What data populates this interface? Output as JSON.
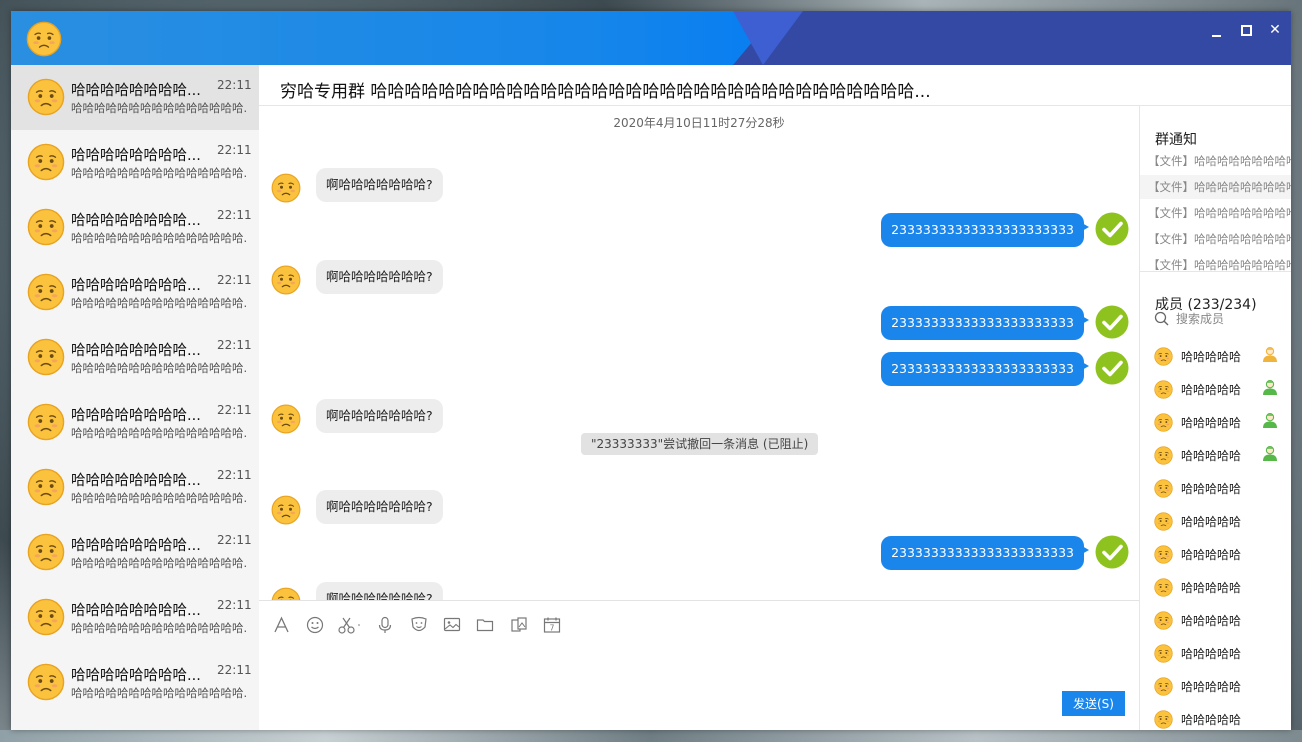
{
  "titlebar": {
    "controls": {
      "minimize_icon": "minimize-icon",
      "maximize_icon": "maximize-icon",
      "close_label": "✕"
    }
  },
  "sidebar": {
    "items": [
      {
        "name": "哈哈哈哈哈哈哈哈...",
        "time": "22:11",
        "preview": "哈哈哈哈哈哈哈哈哈哈哈哈哈哈哈...",
        "active": true
      },
      {
        "name": "哈哈哈哈哈哈哈哈...",
        "time": "22:11",
        "preview": "哈哈哈哈哈哈哈哈哈哈哈哈哈哈哈..."
      },
      {
        "name": "哈哈哈哈哈哈哈哈...",
        "time": "22:11",
        "preview": "哈哈哈哈哈哈哈哈哈哈哈哈哈哈哈..."
      },
      {
        "name": "哈哈哈哈哈哈哈哈...",
        "time": "22:11",
        "preview": "哈哈哈哈哈哈哈哈哈哈哈哈哈哈哈..."
      },
      {
        "name": "哈哈哈哈哈哈哈哈...",
        "time": "22:11",
        "preview": "哈哈哈哈哈哈哈哈哈哈哈哈哈哈哈..."
      },
      {
        "name": "哈哈哈哈哈哈哈哈...",
        "time": "22:11",
        "preview": "哈哈哈哈哈哈哈哈哈哈哈哈哈哈哈..."
      },
      {
        "name": "哈哈哈哈哈哈哈哈...",
        "time": "22:11",
        "preview": "哈哈哈哈哈哈哈哈哈哈哈哈哈哈哈..."
      },
      {
        "name": "哈哈哈哈哈哈哈哈...",
        "time": "22:11",
        "preview": "哈哈哈哈哈哈哈哈哈哈哈哈哈哈哈..."
      },
      {
        "name": "哈哈哈哈哈哈哈哈...",
        "time": "22:11",
        "preview": "哈哈哈哈哈哈哈哈哈哈哈哈哈哈哈..."
      },
      {
        "name": "哈哈哈哈哈哈哈哈...",
        "time": "22:11",
        "preview": "哈哈哈哈哈哈哈哈哈哈哈哈哈哈哈..."
      }
    ]
  },
  "chat": {
    "title": "穷哈专用群 哈哈哈哈哈哈哈哈哈哈哈哈哈哈哈哈哈哈哈哈哈哈哈哈哈哈哈哈哈哈哈哈...",
    "timestamp": "2020年4月10日11时27分28秒",
    "messages": [
      {
        "dir": "in",
        "text": "啊哈哈哈哈哈哈哈?"
      },
      {
        "dir": "out",
        "text": "23333333333333333333333"
      },
      {
        "dir": "in",
        "text": "啊哈哈哈哈哈哈哈?"
      },
      {
        "dir": "out",
        "text": "23333333333333333333333"
      },
      {
        "dir": "out",
        "text": "23333333333333333333333"
      },
      {
        "dir": "in",
        "text": "啊哈哈哈哈哈哈哈?"
      },
      {
        "dir": "in",
        "text": "啊哈哈哈哈哈哈哈?"
      },
      {
        "dir": "out",
        "text": "23333333333333333333333"
      },
      {
        "dir": "in",
        "text": "啊哈哈哈哈哈哈哈?"
      }
    ],
    "system_notice": "\"23333333\"尝试撤回一条消息 (已阻止)"
  },
  "input": {
    "toolbar": [
      "font-icon",
      "emoji-icon",
      "scissors-icon",
      "microphone-icon",
      "sticker-icon",
      "image-icon",
      "folder-icon",
      "gallery-icon",
      "calendar-icon"
    ],
    "calendar_day": "7",
    "send_label": "发送(S)"
  },
  "right_panel": {
    "notice_title": "群通知",
    "notices": [
      "【文件】哈哈哈哈哈哈哈哈哈",
      "【文件】哈哈哈哈哈哈哈哈哈",
      "【文件】哈哈哈哈哈哈哈哈哈",
      "【文件】哈哈哈哈哈哈哈哈哈",
      "【文件】哈哈哈哈哈哈哈哈哈"
    ],
    "members_title": "成员 (233/234)",
    "search_placeholder": "搜索成员",
    "members": [
      {
        "name": "哈哈哈哈哈",
        "role": "owner"
      },
      {
        "name": "哈哈哈哈哈",
        "role": "admin"
      },
      {
        "name": "哈哈哈哈哈",
        "role": "admin"
      },
      {
        "name": "哈哈哈哈哈",
        "role": "admin"
      },
      {
        "name": "哈哈哈哈哈"
      },
      {
        "name": "哈哈哈哈哈"
      },
      {
        "name": "哈哈哈哈哈"
      },
      {
        "name": "哈哈哈哈哈"
      },
      {
        "name": "哈哈哈哈哈"
      },
      {
        "name": "哈哈哈哈哈"
      },
      {
        "name": "哈哈哈哈哈"
      },
      {
        "name": "哈哈哈哈哈"
      }
    ]
  },
  "colors": {
    "accent": "#1a86ec",
    "check_green": "#8dc21f",
    "owner_gold": "#f0b43c",
    "admin_green": "#57b84a"
  }
}
